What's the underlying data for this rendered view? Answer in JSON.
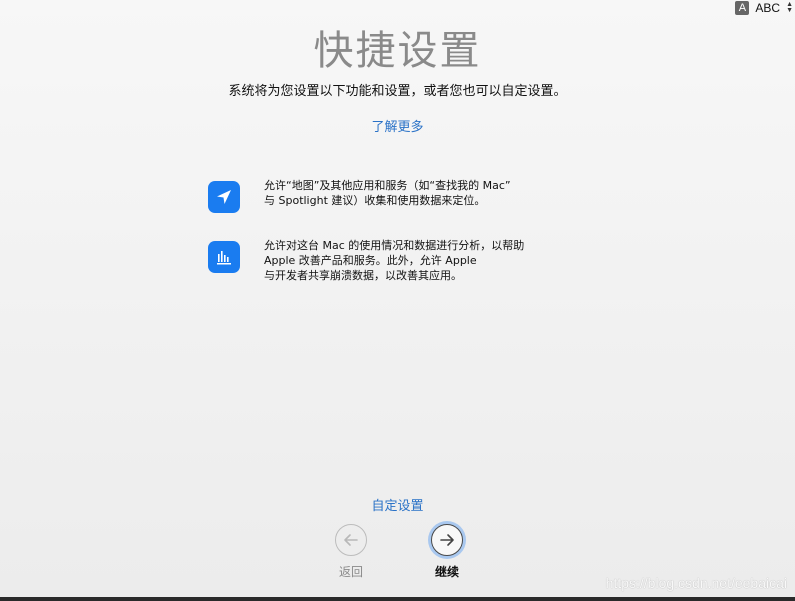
{
  "input_menu": {
    "badge": "A",
    "label": "ABC"
  },
  "title": "快捷设置",
  "subtitle": "系统将为您设置以下功能和设置，或者您也可以自定设置。",
  "learn_more": "了解更多",
  "features": [
    {
      "icon": "location-arrow-icon",
      "lines": [
        "允许“地图”及其他应用和服务（如“查找我的 Mac”",
        "与 Spotlight 建议）收集和使用数据来定位。"
      ]
    },
    {
      "icon": "analytics-chart-icon",
      "lines": [
        "允许对这台 Mac 的使用情况和数据进行分析，以帮助",
        "Apple 改善产品和服务。此外，允许 Apple",
        "与开发者共享崩溃数据，以改善其应用。"
      ]
    }
  ],
  "custom_setup": "自定设置",
  "nav": {
    "back_label": "返回",
    "continue_label": "继续"
  },
  "colors": {
    "accent": "#1a7cf0",
    "link": "#2a72c7",
    "title": "#8a8a8a"
  },
  "watermark": "https://blog.csdn.net/eebaicai"
}
